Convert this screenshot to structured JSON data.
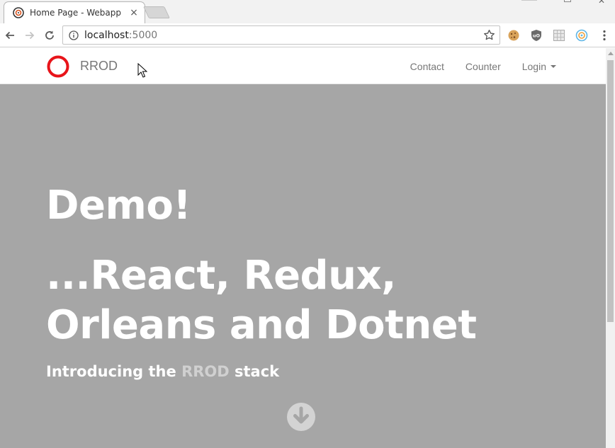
{
  "browser": {
    "tab_title": "Home Page - Webapp",
    "tab_close": "×",
    "window_close": "✕",
    "url_host": "localhost",
    "url_port": ":5000"
  },
  "navbar": {
    "brand": "RROD",
    "links": [
      {
        "label": "Contact"
      },
      {
        "label": "Counter"
      },
      {
        "label": "Login"
      }
    ]
  },
  "hero": {
    "title": "Demo!",
    "subtitle": "...React, Redux, Orleans and Dotnet",
    "tagline_prefix": "Introducing the ",
    "tagline_accent": "RROD",
    "tagline_suffix": " stack"
  },
  "colors": {
    "hero_bg": "#a6a6a6",
    "brand_ring": "#e8141a",
    "nav_text": "#777777",
    "accent_text": "#d0d0d0"
  },
  "icons": [
    "favicon-icon",
    "back-arrow-icon",
    "forward-arrow-icon",
    "reload-icon",
    "info-icon",
    "star-icon",
    "cookie-icon",
    "ublock-icon",
    "grid-extension-icon",
    "target-extension-icon",
    "more-icon",
    "down-arrow-circle-icon",
    "mouse-cursor-icon"
  ]
}
